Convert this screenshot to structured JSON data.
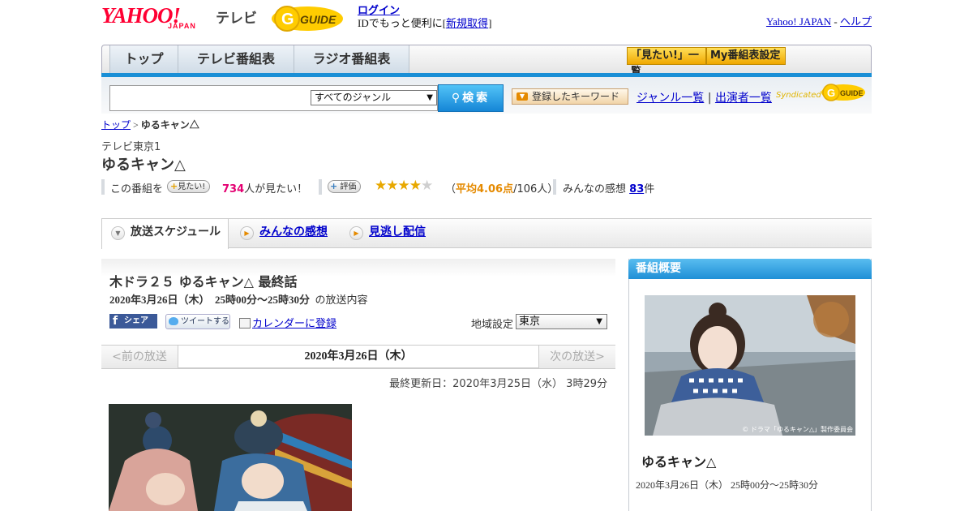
{
  "header": {
    "logo_yahoo": "YAHOO!",
    "logo_japan": "JAPAN",
    "logo_tv": "テレビ",
    "gguide_logo": "G-GUIDE",
    "login_link": "ログイン",
    "login_prompt_prefix": "IDでもっと便利に[",
    "signup_link": "新規取得",
    "login_prompt_suffix": "]",
    "yahoo_japan_link": "Yahoo! JAPAN",
    "separator": "-",
    "help_link": "ヘルプ"
  },
  "nav": {
    "tabs": [
      {
        "label": "トップ"
      },
      {
        "label": "テレビ番組表"
      },
      {
        "label": "ラジオ番組表"
      }
    ],
    "mitai_list_button": "「見たい!」一覧",
    "my_schedule_button": "My番組表設定"
  },
  "search": {
    "input_value": "",
    "genre_select": "すべてのジャンル",
    "search_button": "検索",
    "registered_keyword_button": "登録したキーワード",
    "genre_list_link": "ジャンル一覧",
    "link_separator": "|",
    "performer_list_link": "出演者一覧",
    "syndicated_text": "Syndicated"
  },
  "breadcrumb": {
    "home_link": "トップ",
    "separator": ">",
    "current": "ゆるキャン△"
  },
  "program": {
    "station": "テレビ東京1",
    "title": "ゆるキャン△",
    "want_prefix": "この番組を",
    "want_button": "見たい!",
    "want_count": "734",
    "want_suffix": "人が見たい！",
    "rating_button": "評価",
    "rating_stars_filled": 4,
    "rating_stars_total": 5,
    "rating_open": "（",
    "rating_average": "平均4.06点",
    "rating_count": "/106人）",
    "impressions_prefix": "みんなの感想",
    "impressions_count": "83",
    "impressions_suffix": "件"
  },
  "tabs": [
    {
      "label": "放送スケジュール",
      "active": true
    },
    {
      "label": "みんなの感想",
      "active": false
    },
    {
      "label": "見逃し配信",
      "active": false
    }
  ],
  "episode": {
    "title": "木ドラ２５ ゆるキャン△ 最終話",
    "broadcast_date": "2020年3月26日（木）",
    "broadcast_time": "25時00分～25時30分",
    "broadcast_suffix": "の放送内容",
    "facebook_share": "シェア",
    "tweet_button": "ツイートする",
    "calendar_link": "カレンダーに登録",
    "region_label": "地域設定",
    "region_value": "東京"
  },
  "pager": {
    "prev": "<前の放送",
    "current": "2020年3月26日（木）",
    "next": "次の放送>"
  },
  "last_updated": "最終更新日：2020年3月25日（水） 3時29分",
  "sidebar": {
    "heading": "番組概要",
    "photo_credit": "© ドラマ「ゆるキャン△」製作委員会",
    "title": "ゆるキャン△",
    "date_time": "2020年3月26日（木） 25時00分～25時30分"
  },
  "colors": {
    "yahoo_red": "#ff0033",
    "nav_blue": "#1a8fd6",
    "link_blue": "#0000cc",
    "want_pink": "#e40072",
    "rating_orange": "#e58a00",
    "star_gold": "#e8a800",
    "gguide_yellow": "#ffcc00"
  }
}
